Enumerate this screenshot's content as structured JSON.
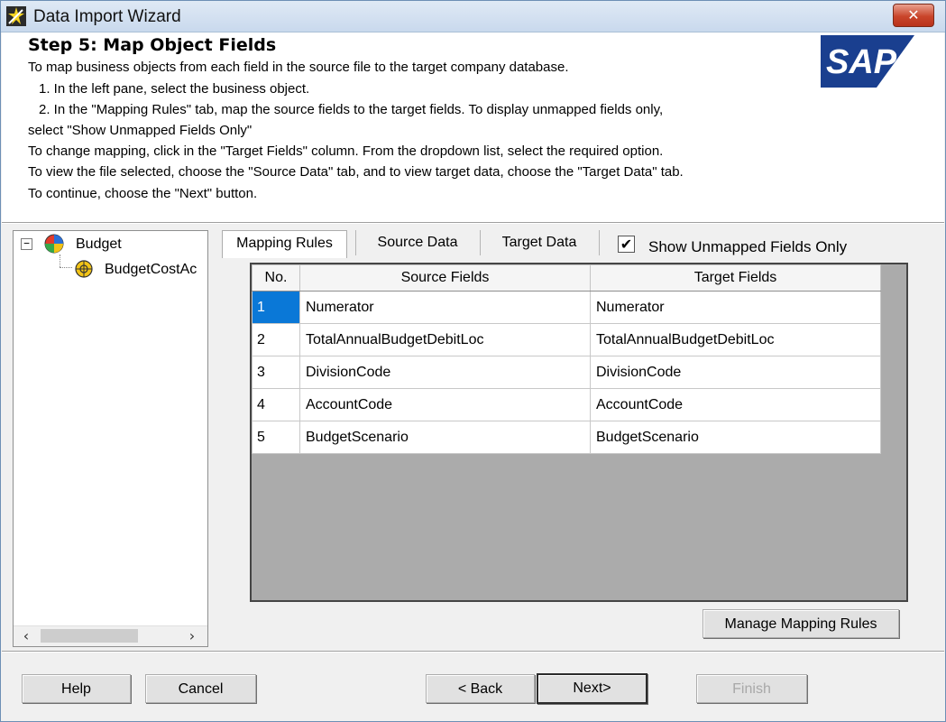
{
  "window": {
    "title": "Data Import Wizard",
    "close_label": "✕"
  },
  "header": {
    "step_title": "Step 5: Map Object Fields",
    "instructions": [
      "To map business objects from each field in the source file to the target company database.",
      "1. In the left pane, select the business object.",
      "2. In the \"Mapping Rules\" tab, map the source fields to the target fields. To display unmapped fields only,",
      "select \"Show Unmapped Fields Only\"",
      "To change mapping, click in the \"Target Fields\" column. From the dropdown list, select the required option.",
      "To view the file selected, choose the \"Source Data\" tab, and to view target data, choose the \"Target Data\" tab.",
      "To continue, choose the \"Next\" button."
    ],
    "logo_text": "SAP"
  },
  "tree": {
    "root_label": "Budget",
    "child_label": "BudgetCostAc",
    "expander": "−"
  },
  "tabs": [
    {
      "label": "Mapping Rules",
      "active": true
    },
    {
      "label": "Source Data",
      "active": false
    },
    {
      "label": "Target Data",
      "active": false
    }
  ],
  "show_unmapped": {
    "label": "Show Unmapped Fields Only",
    "checked": true,
    "check_glyph": "✔"
  },
  "grid": {
    "columns": [
      "No.",
      "Source  Fields",
      "Target Fields"
    ],
    "rows": [
      {
        "no": "1",
        "source": "Numerator",
        "target": "Numerator",
        "selected": true
      },
      {
        "no": "2",
        "source": "TotalAnnualBudgetDebitLoc",
        "target": "TotalAnnualBudgetDebitLoc",
        "selected": false
      },
      {
        "no": "3",
        "source": "DivisionCode",
        "target": "DivisionCode",
        "selected": false
      },
      {
        "no": "4",
        "source": "AccountCode",
        "target": "AccountCode",
        "selected": false
      },
      {
        "no": "5",
        "source": "BudgetScenario",
        "target": "BudgetScenario",
        "selected": false
      }
    ]
  },
  "buttons": {
    "manage_mapping_rules": "Manage Mapping Rules",
    "help": "Help",
    "cancel": "Cancel",
    "back": "< Back",
    "next": "Next>",
    "finish": "Finish"
  },
  "scrollbar": {
    "left_arrow": "‹",
    "right_arrow": "›"
  },
  "colors": {
    "selection": "#0a78d7",
    "sap_blue": "#1a3f8f"
  }
}
